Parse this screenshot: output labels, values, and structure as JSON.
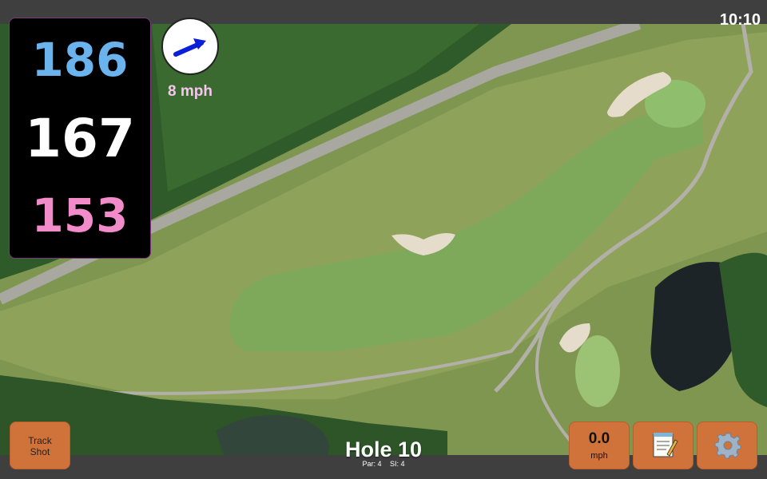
{
  "status": {
    "time": "10:10"
  },
  "yardages": {
    "back": "186",
    "middle": "167",
    "front": "153"
  },
  "wind": {
    "speed_label": "8 mph",
    "arrow_icon": "wind-direction-arrow-icon"
  },
  "buttons": {
    "track_shot_line1": "Track",
    "track_shot_line2": "Shot",
    "wind_value": "0.0",
    "wind_unit": "mph",
    "notes_icon": "notepad-icon",
    "settings_icon": "gear-icon"
  },
  "hole": {
    "title": "Hole 10",
    "par": "Par: 4",
    "si": "SI: 4"
  },
  "colors": {
    "back_yardage": "#6bb3ec",
    "middle_yardage": "#ffffff",
    "front_yardage": "#f28bc9",
    "button": "#d0733a",
    "wind_arrow": "#0a1fd8"
  }
}
